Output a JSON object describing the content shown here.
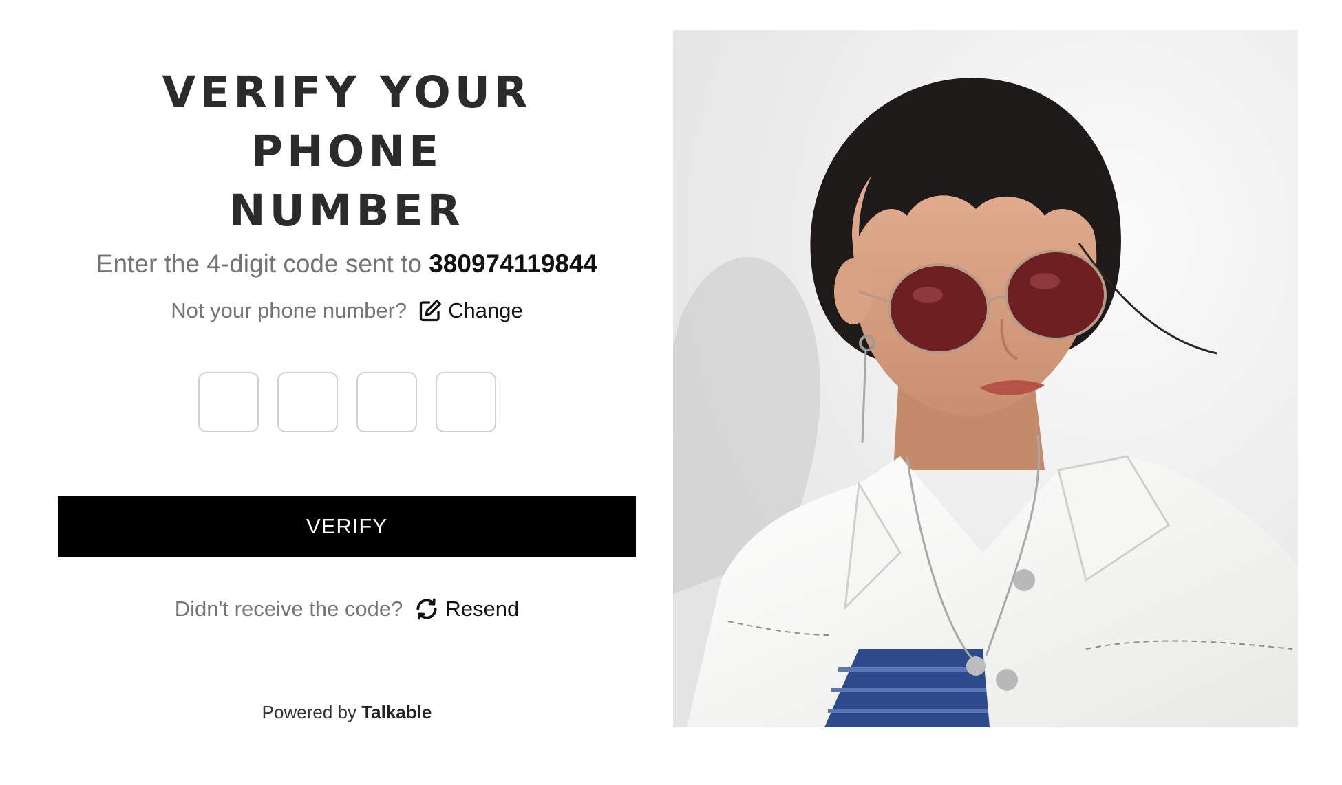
{
  "heading": {
    "line1": "VERIFY YOUR PHONE",
    "line2": "NUMBER"
  },
  "instructions": {
    "prefix": "Enter the 4-digit code sent to",
    "phone": "380974119844"
  },
  "change": {
    "prompt": "Not your phone number?",
    "link_label": "Change",
    "icon": "edit-icon"
  },
  "code_inputs": {
    "count": 4,
    "values": [
      "",
      "",
      "",
      ""
    ]
  },
  "verify_button": {
    "label": "VERIFY"
  },
  "resend": {
    "prompt": "Didn't receive the code?",
    "link_label": "Resend",
    "icon": "refresh-icon"
  },
  "footer": {
    "prefix": "Powered by",
    "brand": "Talkable"
  },
  "colors": {
    "button_bg": "#000000",
    "muted_text": "#757575",
    "heading_text": "#2b2b2b"
  }
}
